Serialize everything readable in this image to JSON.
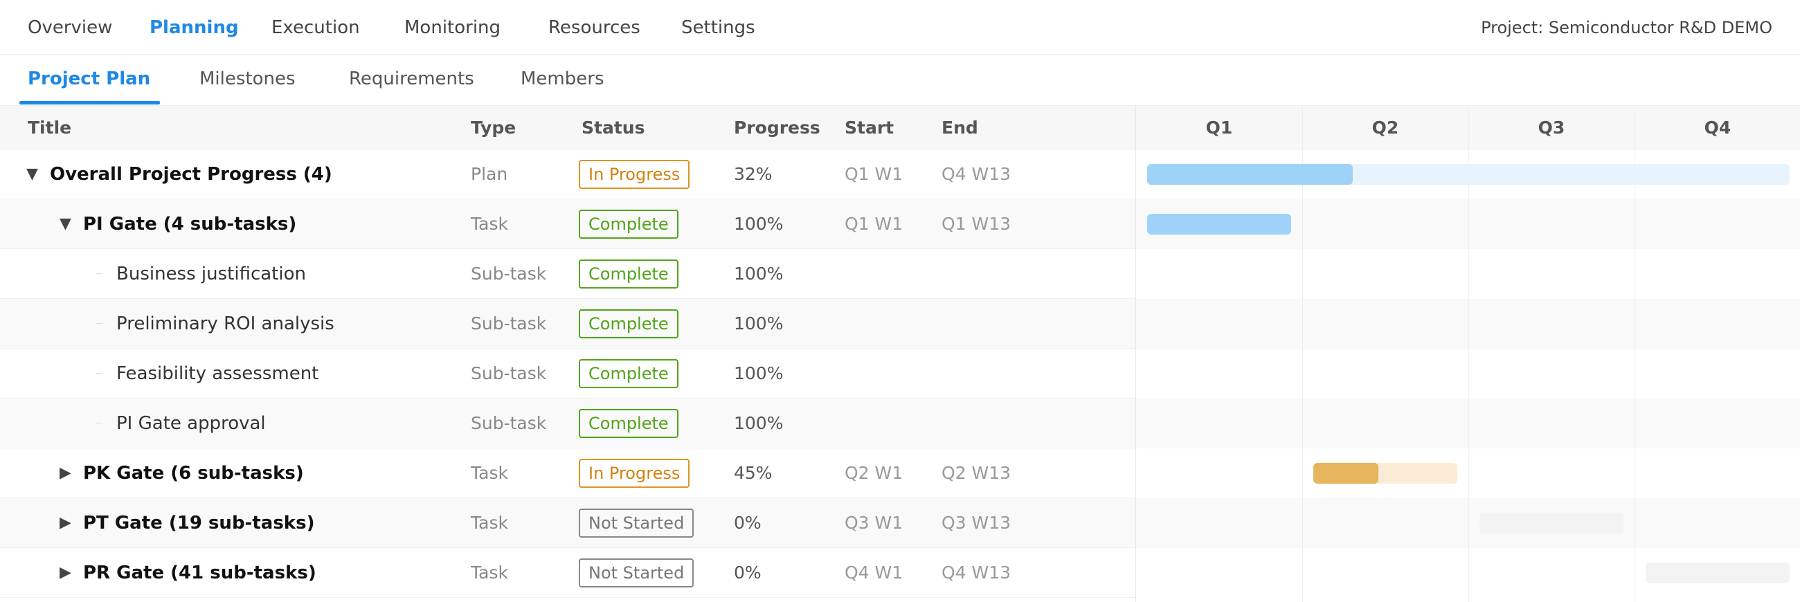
{
  "topnav": {
    "tabs": [
      "Overview",
      "Planning",
      "Execution",
      "Monitoring",
      "Resources",
      "Settings"
    ],
    "project_label": "Project: Semiconductor R&D DEMO"
  },
  "subnav": {
    "tabs": [
      "Project Plan",
      "Milestones",
      "Requirements",
      "Members"
    ]
  },
  "table": {
    "headers": {
      "title": "Title",
      "type": "Type",
      "status": "Status",
      "progress": "Progress",
      "start": "Start",
      "end": "End"
    },
    "rows": [
      {
        "toggle": "▼",
        "title": "Overall Project Progress (4)",
        "type": "Plan",
        "status": "In Progress",
        "progress": "32%",
        "start": "Q1 W1",
        "end": "Q4 W13"
      },
      {
        "toggle": "▼",
        "title": "PI Gate (4 sub-tasks)",
        "type": "Task",
        "status": "Complete",
        "progress": "100%",
        "start": "Q1 W1",
        "end": "Q1 W13"
      },
      {
        "toggle": "",
        "title": "Business justification",
        "type": "Sub-task",
        "status": "Complete",
        "progress": "100%",
        "start": "",
        "end": ""
      },
      {
        "toggle": "",
        "title": "Preliminary ROI analysis",
        "type": "Sub-task",
        "status": "Complete",
        "progress": "100%",
        "start": "",
        "end": ""
      },
      {
        "toggle": "",
        "title": "Feasibility assessment",
        "type": "Sub-task",
        "status": "Complete",
        "progress": "100%",
        "start": "",
        "end": ""
      },
      {
        "toggle": "",
        "title": "PI Gate approval",
        "type": "Sub-task",
        "status": "Complete",
        "progress": "100%",
        "start": "",
        "end": ""
      },
      {
        "toggle": "▶",
        "title": "PK Gate (6 sub-tasks)",
        "type": "Task",
        "status": "In Progress",
        "progress": "45%",
        "start": "Q2 W1",
        "end": "Q2 W13"
      },
      {
        "toggle": "▶",
        "title": "PT Gate (19 sub-tasks)",
        "type": "Task",
        "status": "Not Started",
        "progress": "0%",
        "start": "Q3 W1",
        "end": "Q3 W13"
      },
      {
        "toggle": "▶",
        "title": "PR Gate (41 sub-tasks)",
        "type": "Task",
        "status": "Not Started",
        "progress": "0%",
        "start": "Q4 W1",
        "end": "Q4 W13"
      }
    ]
  },
  "gantt": {
    "quarters": [
      "Q1",
      "Q2",
      "Q3",
      "Q4"
    ],
    "colors": {
      "blue_fill": "#9fd2f8",
      "blue_track": "#e8f4fd",
      "orange_fill": "#e5b45c",
      "orange_track": "#faebd4",
      "gray_track": "#f3f3f3"
    }
  }
}
